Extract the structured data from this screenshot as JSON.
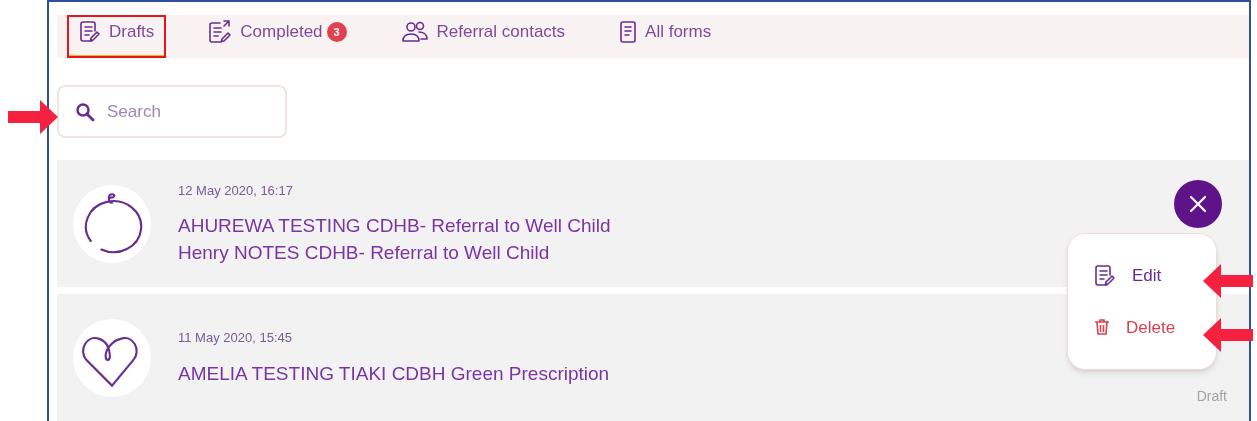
{
  "tabs": [
    {
      "label": "Drafts",
      "kind": "drafts",
      "selected": true
    },
    {
      "label": "Completed",
      "kind": "completed",
      "badge": "3",
      "selected": false
    },
    {
      "label": "Referral contacts",
      "kind": "contacts",
      "selected": false
    },
    {
      "label": "All forms",
      "kind": "forms",
      "selected": false
    }
  ],
  "search": {
    "placeholder": "Search"
  },
  "items": [
    {
      "kind": "baby",
      "date": "12 May 2020, 16:17",
      "lines": [
        "AHUREWA TESTING CDHB- Referral to Well Child",
        "Henry NOTES CDHB- Referral to Well Child"
      ],
      "menu_open": true
    },
    {
      "kind": "heart",
      "date": "11 May 2020, 15:45",
      "lines": [
        "AMELIA TESTING TIAKI CDBH Green Prescription"
      ],
      "status": "Draft",
      "menu_open": false
    }
  ],
  "menu": {
    "items": [
      {
        "label": "Edit",
        "kind": "edit"
      },
      {
        "label": "Delete",
        "kind": "delete"
      }
    ]
  }
}
